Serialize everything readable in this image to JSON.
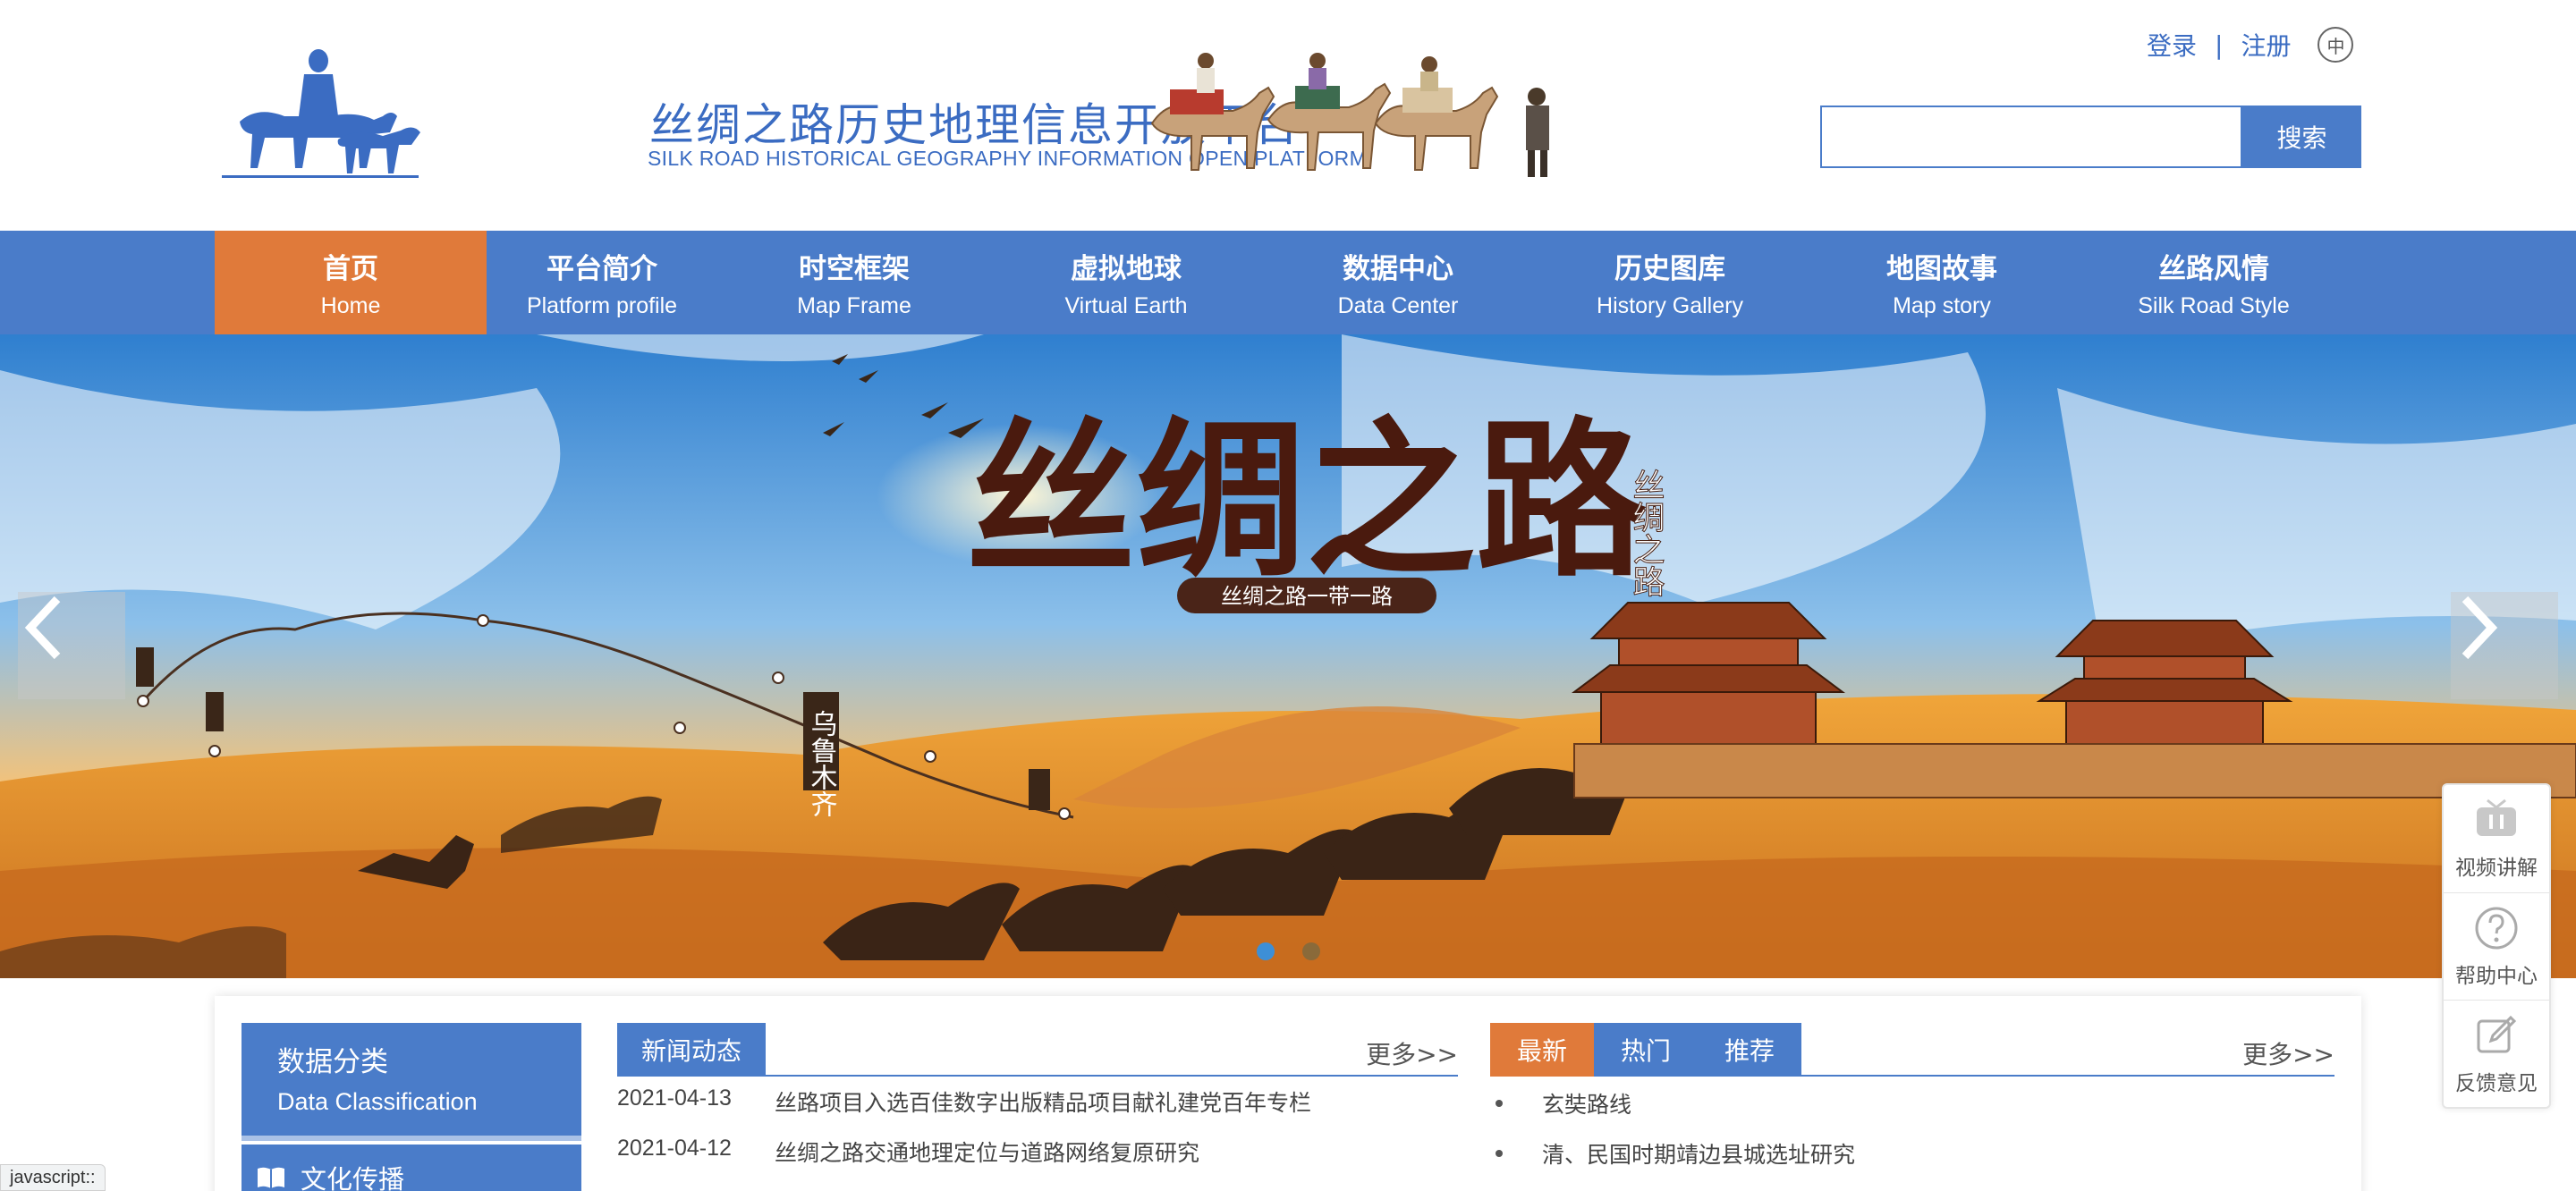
{
  "header": {
    "site_title": "丝绸之路历史地理信息开放平台",
    "site_subtitle": "SILK ROAD HISTORICAL GEOGRAPHY INFORMATION OPEN PLATFORM",
    "login": "登录",
    "separator": "|",
    "register": "注册",
    "language": "中",
    "search_placeholder": "",
    "search_button": "搜索"
  },
  "nav": [
    {
      "cn": "首页",
      "en": "Home",
      "active": true
    },
    {
      "cn": "平台简介",
      "en": "Platform profile"
    },
    {
      "cn": "时空框架",
      "en": "Map Frame"
    },
    {
      "cn": "虚拟地球",
      "en": "Virtual Earth"
    },
    {
      "cn": "数据中心",
      "en": "Data Center"
    },
    {
      "cn": "历史图库",
      "en": "History Gallery"
    },
    {
      "cn": "地图故事",
      "en": "Map story"
    },
    {
      "cn": "丝路风情",
      "en": "Silk Road Style"
    }
  ],
  "banner": {
    "title": "丝绸之路",
    "vertical_text": "丝绸之路",
    "slogan": "丝绸之路一带一路",
    "city_label": "乌鲁木齐",
    "slide_count": 2,
    "active_slide": 1
  },
  "side_tools": [
    {
      "label": "视频讲解",
      "icon": "tv-icon"
    },
    {
      "label": "帮助中心",
      "icon": "help-icon"
    },
    {
      "label": "反馈意见",
      "icon": "edit-icon"
    }
  ],
  "data_classification": {
    "title_cn": "数据分类",
    "title_en": "Data Classification",
    "items": [
      "文化传播"
    ]
  },
  "news": {
    "tab": "新闻动态",
    "more": "更多>>",
    "items": [
      {
        "date": "2021-04-13",
        "title": "丝路项目入选百佳数字出版精品项目献礼建党百年专栏"
      },
      {
        "date": "2021-04-12",
        "title": "丝绸之路交通地理定位与道路网络复原研究"
      }
    ]
  },
  "recommend": {
    "tabs": [
      "最新",
      "热门",
      "推荐"
    ],
    "active_tab": 0,
    "more": "更多>>",
    "items": [
      "玄奘路线",
      "清、民国时期靖边县城选址研究"
    ]
  },
  "status_bar": "javascript::",
  "colors": {
    "primary_blue": "#4a7cc9",
    "accent_orange": "#e07a3a",
    "sand": "#e8a23a",
    "sky": "#3d8fd6"
  }
}
